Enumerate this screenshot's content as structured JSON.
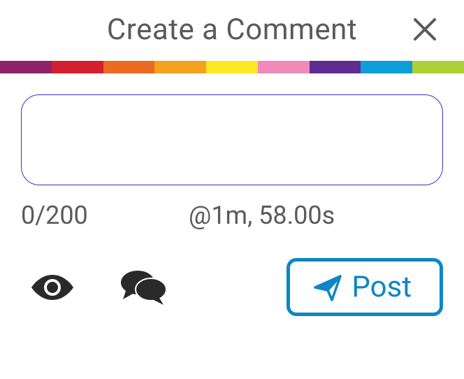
{
  "header": {
    "title": "Create a Comment"
  },
  "input": {
    "value": "",
    "placeholder": ""
  },
  "meta": {
    "counter": "0/200",
    "timestamp": "@1m, 58.00s"
  },
  "actions": {
    "post_label": "Post"
  },
  "colors": {
    "accent": "#0c87c4",
    "input_border": "#3b2fcf"
  }
}
